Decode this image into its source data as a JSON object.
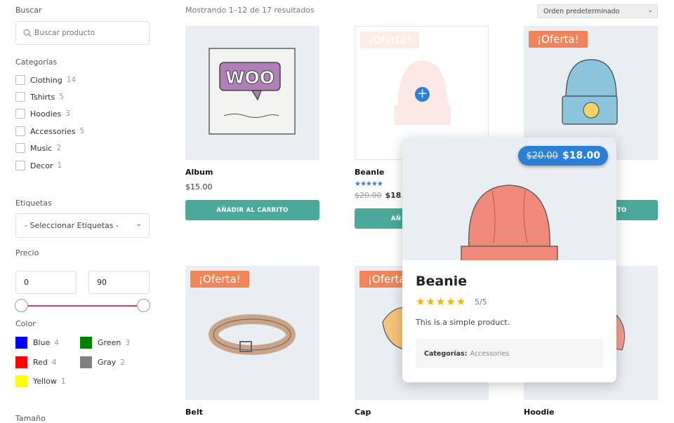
{
  "sidebar": {
    "search_heading": "Buscar",
    "search_placeholder": "Buscar producto",
    "categories_heading": "Categorías",
    "categories": [
      {
        "label": "Clothing",
        "count": "14"
      },
      {
        "label": "Tshirts",
        "count": "5"
      },
      {
        "label": "Hoodies",
        "count": "3"
      },
      {
        "label": "Accessories",
        "count": "5"
      },
      {
        "label": "Music",
        "count": "2"
      },
      {
        "label": "Decor",
        "count": "1"
      }
    ],
    "tags_heading": "Etiquetas",
    "tags_select": "- Seleccionar Etiquetas -",
    "price_heading": "Precio",
    "price_min": "0",
    "price_max": "90",
    "color_heading": "Color",
    "colors": [
      {
        "label": "Blue",
        "count": "4",
        "hex": "#0000ff"
      },
      {
        "label": "Green",
        "count": "3",
        "hex": "#008000"
      },
      {
        "label": "Red",
        "count": "4",
        "hex": "#ff0000"
      },
      {
        "label": "Gray",
        "count": "2",
        "hex": "#808080"
      },
      {
        "label": "Yellow",
        "count": "1",
        "hex": "#ffff00"
      }
    ],
    "size_heading": "Tamaño"
  },
  "toolbar": {
    "results": "Mostrando 1–12 de 17 resultados",
    "order": "Orden predeterminado"
  },
  "products": [
    {
      "name": "Album",
      "price": "$15.00",
      "button": "AÑADIR AL CARRITO"
    },
    {
      "name": "Beanie",
      "old_price": "$20.00",
      "price": "$18.00",
      "badge": "¡Oferta!",
      "button": "AÑ",
      "stars": "★★★★★"
    },
    {
      "name": "",
      "badge": "¡Oferta!",
      "button": "AÑADIR AL CARRITO"
    },
    {
      "name": "Belt",
      "badge": "¡Oferta!"
    },
    {
      "name": "Cap",
      "badge": "¡Oferta!"
    },
    {
      "name": "Hoodie"
    }
  ],
  "quickview": {
    "old_price": "$20.00",
    "price": "$18.00",
    "title": "Beanie",
    "stars": "★★★★★",
    "rating": "5/5",
    "description": "This is a simple product.",
    "cat_label": "Categorías:",
    "cat_value": "Accessories"
  },
  "accent": {
    "green": "#4aa99a",
    "sale": "#f0855a",
    "blue": "#2b7fd4",
    "slider": "#d33c66"
  }
}
